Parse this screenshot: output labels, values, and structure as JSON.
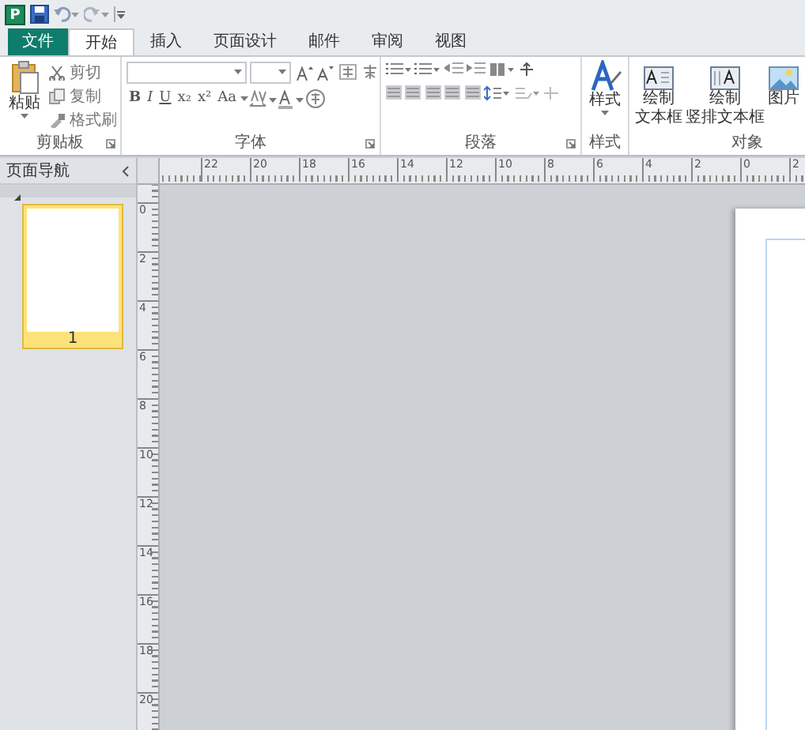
{
  "quick_access": {
    "app_badge": "P"
  },
  "tabs": [
    {
      "label": "文件",
      "kind": "file",
      "selected": false
    },
    {
      "label": "开始",
      "kind": "tab",
      "selected": true
    },
    {
      "label": "插入",
      "kind": "tab",
      "selected": false
    },
    {
      "label": "页面设计",
      "kind": "tab",
      "selected": false
    },
    {
      "label": "邮件",
      "kind": "tab",
      "selected": false
    },
    {
      "label": "审阅",
      "kind": "tab",
      "selected": false
    },
    {
      "label": "视图",
      "kind": "tab",
      "selected": false
    }
  ],
  "ribbon": {
    "clipboard": {
      "label": "剪贴板",
      "launcher": true,
      "paste": "粘贴",
      "items": [
        "剪切",
        "复制",
        "格式刷"
      ]
    },
    "font": {
      "label": "字体",
      "launcher": true,
      "format_buttons": [
        "B",
        "I",
        "U",
        "x₂",
        "x²",
        "Aa"
      ]
    },
    "paragraph": {
      "label": "段落",
      "launcher": true
    },
    "styles": {
      "label": "样式",
      "launcher": false,
      "button": "样式"
    },
    "objects": {
      "label": "对象",
      "launcher": false,
      "buttons": [
        {
          "lines": [
            "绘制",
            "文本框"
          ],
          "kind": "textbox"
        },
        {
          "lines": [
            "绘制",
            "竖排文本框"
          ],
          "kind": "vtextbox"
        },
        {
          "lines": [
            "图片"
          ],
          "kind": "picture"
        }
      ]
    }
  },
  "nav_pane": {
    "title": "页面导航",
    "pages": [
      {
        "label": "1",
        "selected": true
      }
    ]
  },
  "rulers": {
    "horizontal": [
      "22",
      "20",
      "18",
      "16",
      "14",
      "12",
      "10",
      "8",
      "6",
      "4",
      "2",
      "0",
      "2"
    ],
    "vertical": [
      "0",
      "2",
      "4",
      "6",
      "8",
      "10",
      "12",
      "14",
      "16",
      "18",
      "20"
    ]
  }
}
